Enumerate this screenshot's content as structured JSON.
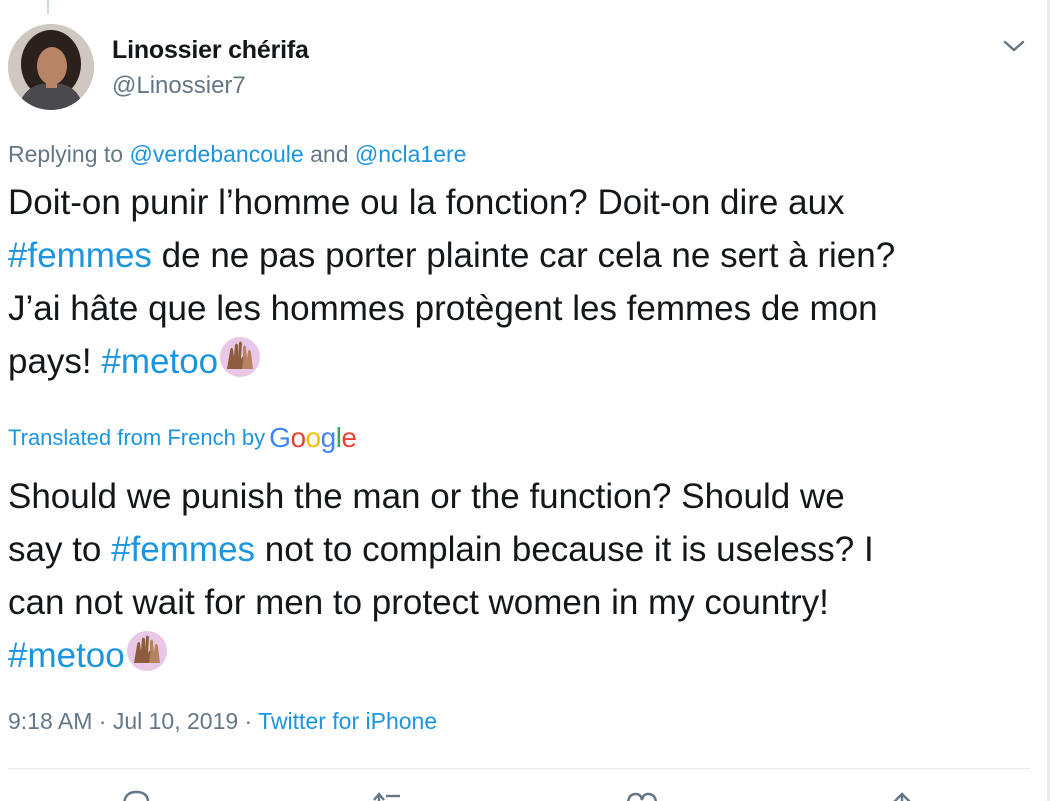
{
  "author": {
    "display_name": "Linossier chérifa",
    "handle": "@Linossier7"
  },
  "reply": {
    "prefix": "Replying to ",
    "user1": "@verdebancoule",
    "joiner": " and ",
    "user2": "@ncla1ere"
  },
  "tweet": {
    "line1": "Doit-on punir l’homme ou la fonction? Doit-on dire aux",
    "line2_hashtag": "#femmes",
    "line2_rest": " de ne pas porter plainte car cela ne sert à rien?",
    "line3": "J’ai hâte que les hommes protègent les femmes de mon",
    "line4_pre": "pays! ",
    "line4_hashtag": "#metoo"
  },
  "translation": {
    "label": "Translated from French by",
    "provider": {
      "letters": [
        "G",
        "o",
        "o",
        "g",
        "l",
        "e"
      ],
      "colors": [
        "#4285f4",
        "#ea4335",
        "#fbbc05",
        "#4285f4",
        "#34a853",
        "#ea4335"
      ]
    },
    "line1": "Should we punish the man or the function? Should we",
    "line2_pre": "say to ",
    "line2_hashtag": "#femmes",
    "line2_rest": " not to complain because it is useless? I",
    "line3": "can not wait for men to protect women in my country!",
    "line4_hashtag": "#metoo"
  },
  "meta": {
    "time_date": "9:18 AM · Jul 10, 2019 · ",
    "source": "Twitter for iPhone"
  },
  "icons": {
    "caret": "chevron-down-icon",
    "emoji": "raising-hands-emoji",
    "actions": [
      "reply-icon",
      "retweet-icon",
      "like-icon",
      "share-icon"
    ]
  },
  "colors": {
    "link": "#1b95e0",
    "secondary_text": "#657786",
    "primary_text": "#14171a",
    "divider": "#e6ecf0"
  }
}
